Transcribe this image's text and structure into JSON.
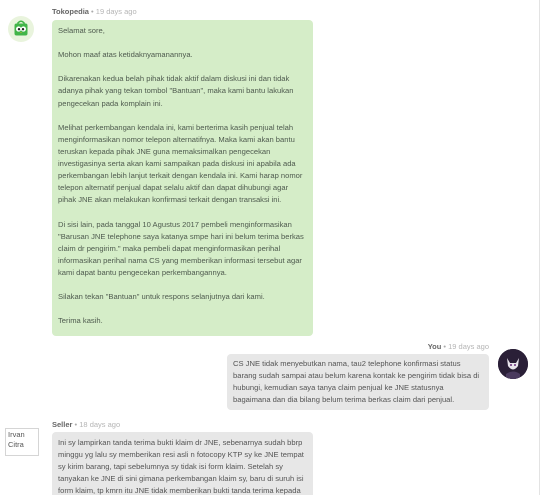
{
  "messages": [
    {
      "sender": "Tokopedia",
      "time": "19 days ago",
      "paragraphs": [
        "Selamat sore,",
        "Mohon maaf atas ketidaknyamanannya.",
        "Dikarenakan kedua belah pihak tidak aktif dalam diskusi ini dan tidak adanya pihak yang tekan tombol \"Bantuan\", maka kami bantu lakukan pengecekan pada komplain ini.",
        "Melihat perkembangan kendala ini, kami berterima kasih penjual telah menginformasikan nomor telepon alternatifnya. Maka kami akan bantu teruskan kepada pihak JNE guna memaksimalkan pengecekan investigasinya serta akan kami sampaikan pada diskusi ini apabila ada perkembangan lebih lanjut terkait dengan kendala ini. Kami harap nomor telepon alternatif penjual dapat selalu aktif dan dapat dihubungi agar pihak JNE akan melakukan konfirmasi terkait dengan transaksi ini.",
        "Di sisi lain, pada tanggal 10 Agustus 2017 pembeli menginformasikan \"Barusan JNE telephone saya katanya smpe hari ini belum terima berkas claim dr pengirim.\" maka pembeli dapat menginformasikan perihal informasikan perihal nama CS yang memberikan informasi tersebut agar kami dapat bantu pengecekan perkembangannya.",
        "Silakan tekan \"Bantuan\" untuk respons selanjutnya dari kami.",
        "Terima kasih."
      ]
    },
    {
      "sender": "You",
      "time": "19 days ago",
      "text": "CS JNE tidak menyebutkan nama, tau2 telephone konfirmasi status barang sudah sampai atau belum karena kontak ke pengirim tidak bisa di hubungi, kemudian saya tanya claim penjual ke JNE statusnya bagaimana dan dia bilang belum terima berkas claim dari penjual."
    },
    {
      "sender": "Seller",
      "time": "18 days ago",
      "card_lines": [
        "Irvan",
        "Citra"
      ],
      "text": "Ini sy lampirkan tanda terima bukti klaim dr JNE, sebenarnya sudah bbrp minggu yg lalu sy memberikan resi asli n fotocopy KTP sy ke JNE tempat sy kirim barang, tapi sebelumnya sy tidak isi form klaim. Setelah sy tanyakan ke JNE di sini gimana perkembangan klaim sy, baru di suruh isi form klaim, tp kmrn itu JNE tidak memberikan bukti tanda terima kepada sy. Akhirnya"
    }
  ],
  "separator": "•",
  "colors": {
    "tokopedia_bubble": "#d5edc8",
    "user_bubble": "#e7e7e7",
    "tokopedia_green": "#42b549",
    "avatar_dark": "#2a1f37"
  },
  "icons": {
    "tokopedia_avatar": "tokopedia-owl-bag-icon",
    "user_avatar": "user-profile-avatar"
  }
}
